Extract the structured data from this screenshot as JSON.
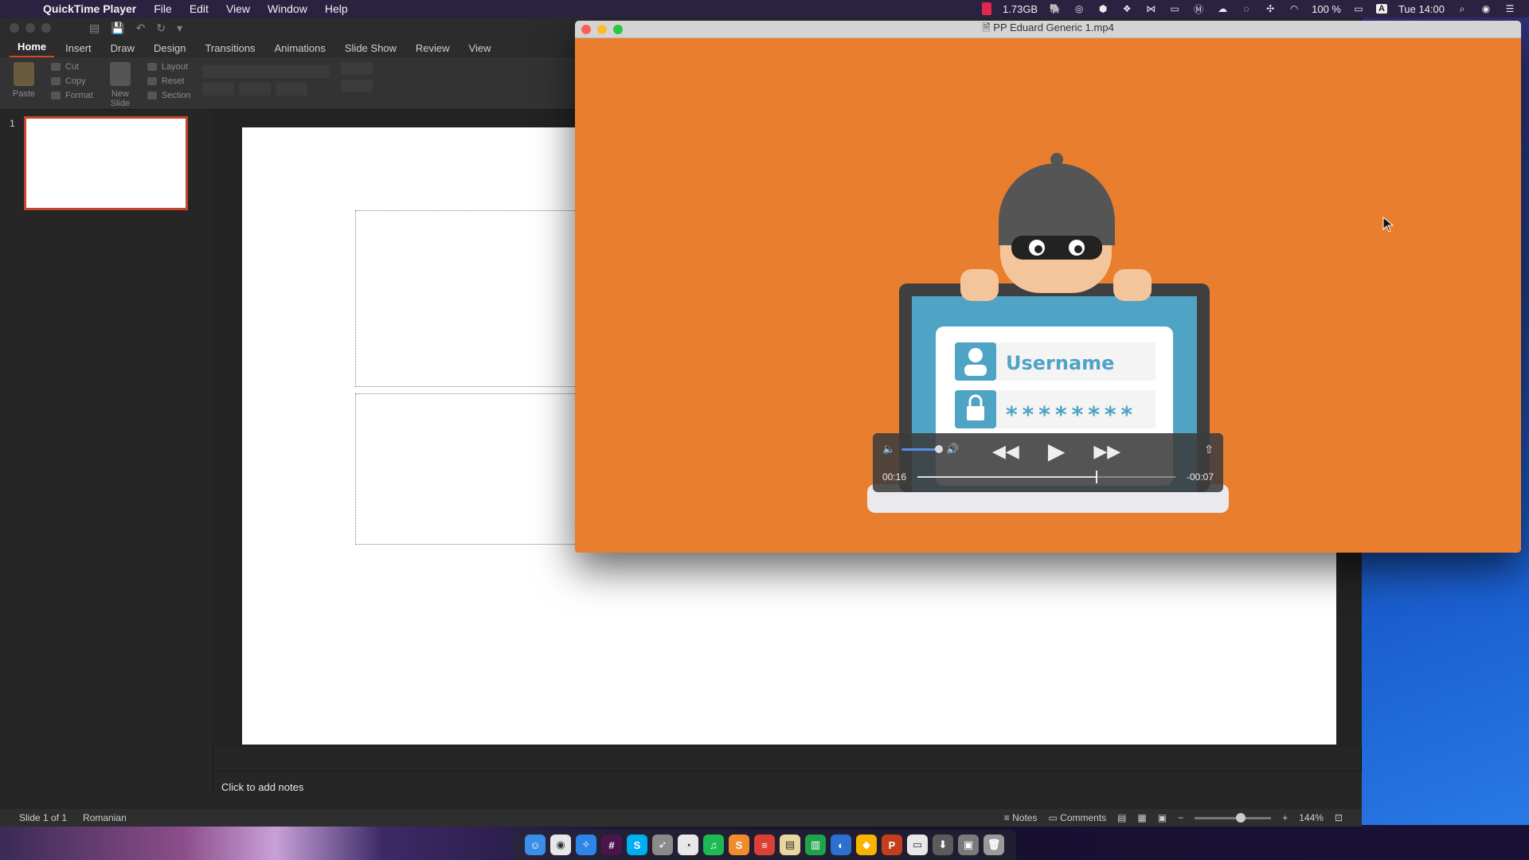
{
  "menubar": {
    "app_name": "QuickTime Player",
    "menus": [
      "File",
      "Edit",
      "View",
      "Window",
      "Help"
    ],
    "network_speed": "1.73GB",
    "battery": "100 %",
    "clock": "Tue 14:00",
    "input_source": "A"
  },
  "ppt": {
    "ribbon_tabs": [
      "Home",
      "Insert",
      "Draw",
      "Design",
      "Transitions",
      "Animations",
      "Slide Show",
      "Review",
      "View"
    ],
    "active_tab": "Home",
    "clipboard": {
      "paste": "Paste",
      "cut": "Cut",
      "copy": "Copy",
      "format": "Format"
    },
    "slides": {
      "new_slide": "New Slide",
      "layout": "Layout",
      "reset": "Reset",
      "section": "Section"
    },
    "thumbnail_number": "1",
    "notes_placeholder": "Click to add notes",
    "status": {
      "slide_count": "Slide 1 of 1",
      "language": "Romanian",
      "notes": "Notes",
      "comments": "Comments",
      "zoom": "144%"
    }
  },
  "quicktime": {
    "title": "PP Eduard Generic 1.mp4",
    "video_text": {
      "username": "Username",
      "password": "********"
    },
    "elapsed": "00:16",
    "remaining": "-00:07",
    "progress_fraction": 0.69,
    "volume_fraction": 1.0
  },
  "dock": {
    "apps": [
      "finder",
      "chrome",
      "safari",
      "slack",
      "skype",
      "launcher",
      "timer",
      "spotify",
      "sublime",
      "todoist",
      "notes",
      "numbers",
      "pixelmator",
      "sketch",
      "powerpoint",
      "preview",
      "downloads",
      "folder",
      "trash"
    ]
  },
  "colors": {
    "video_bg": "#ea7e2f",
    "ppt_accent": "#d24726",
    "laptop_screen": "#4fa3c4"
  }
}
